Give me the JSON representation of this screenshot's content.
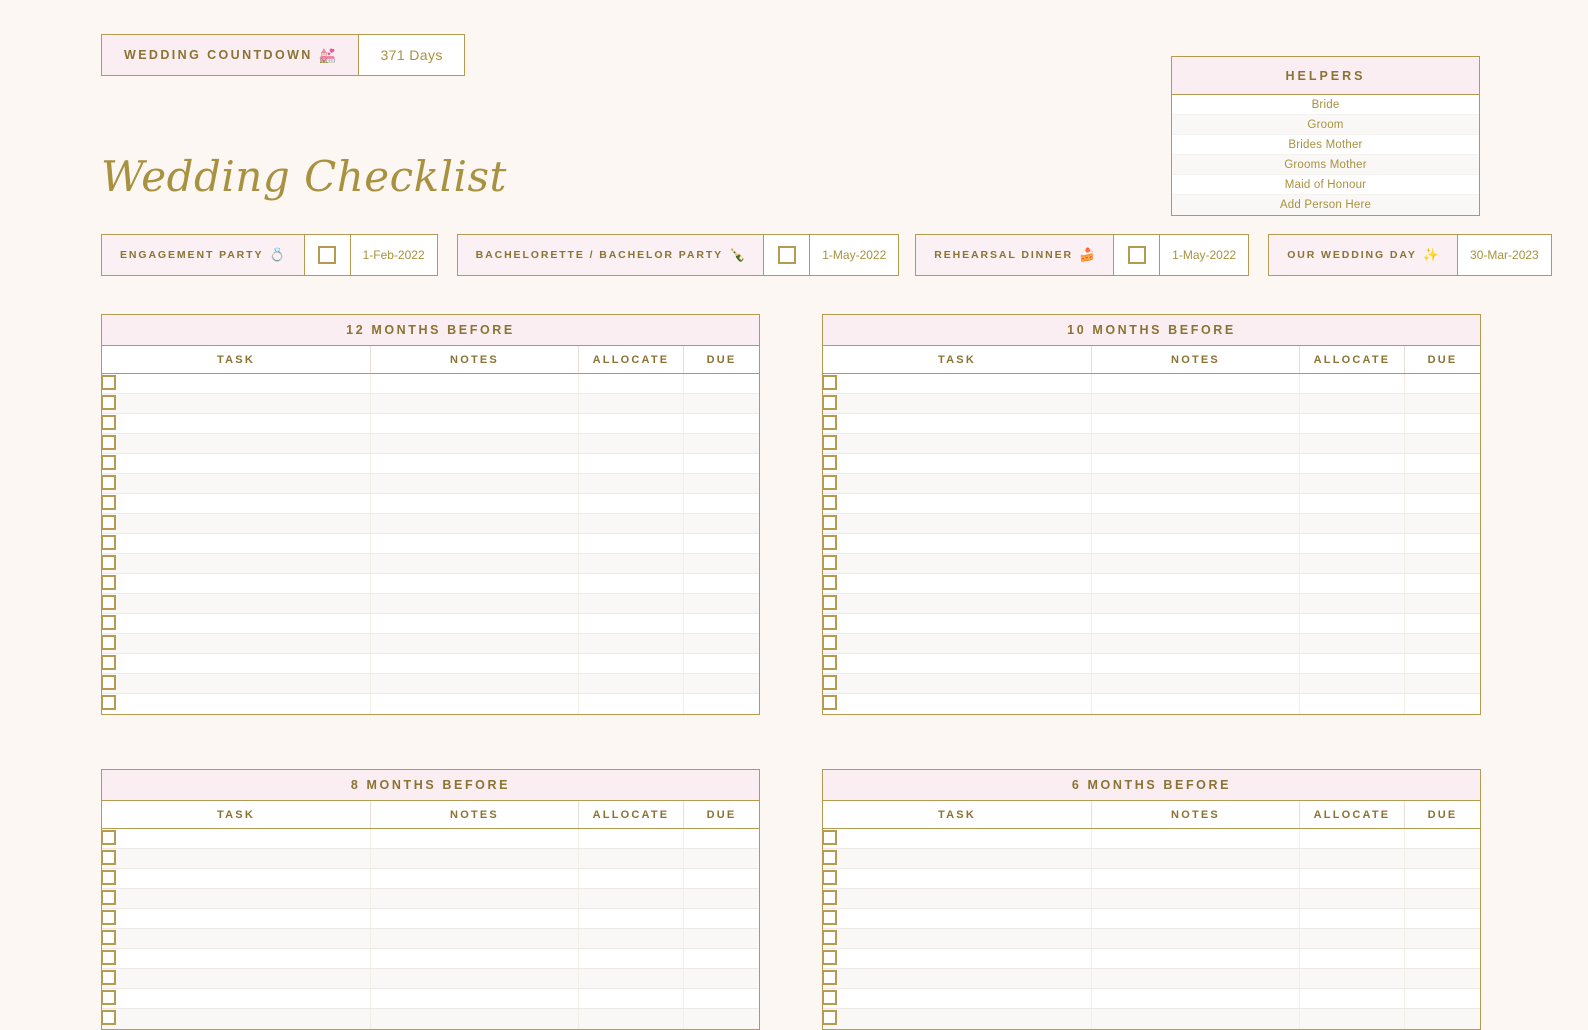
{
  "countdown": {
    "label": "WEDDING COUNTDOWN",
    "icon": "wedding-bells-icon",
    "icon_glyph": "💒",
    "value": "371 Days"
  },
  "helpers": {
    "title": "HELPERS",
    "people": [
      "Bride",
      "Groom",
      "Brides Mother",
      "Grooms Mother",
      "Maid of Honour",
      "Add Person Here"
    ]
  },
  "page_title": "Wedding Checklist",
  "events": [
    {
      "name": "ENGAGEMENT PARTY",
      "icon": "ring-icon",
      "icon_glyph": "💍",
      "checked": false,
      "date": "1-Feb-2022"
    },
    {
      "name": "BACHELORETTE / BACHELOR PARTY",
      "icon": "champagne-bottle-icon",
      "icon_glyph": "🍾",
      "checked": false,
      "date": "1-May-2022"
    },
    {
      "name": "REHEARSAL DINNER",
      "icon": "cake-slice-icon",
      "icon_glyph": "🍰",
      "checked": false,
      "date": "1-May-2022"
    },
    {
      "name": "OUR WEDDING DAY",
      "icon": "sparkles-icon",
      "icon_glyph": "✨",
      "checked": null,
      "date": "30-Mar-2023"
    }
  ],
  "columns": {
    "task": "TASK",
    "notes": "NOTES",
    "allocate": "ALLOCATE",
    "due": "DUE"
  },
  "tables": [
    {
      "title": "12 MONTHS BEFORE",
      "rows": 17
    },
    {
      "title": "10 MONTHS BEFORE",
      "rows": 17
    },
    {
      "title": "8 MONTHS BEFORE",
      "rows": 10
    },
    {
      "title": "6 MONTHS BEFORE",
      "rows": 10
    }
  ],
  "colors": {
    "background": "#fdf7f3",
    "gold": "#b59a52",
    "gold_text": "#a8913f",
    "pink_header": "#fbeef2",
    "white": "#ffffff"
  }
}
